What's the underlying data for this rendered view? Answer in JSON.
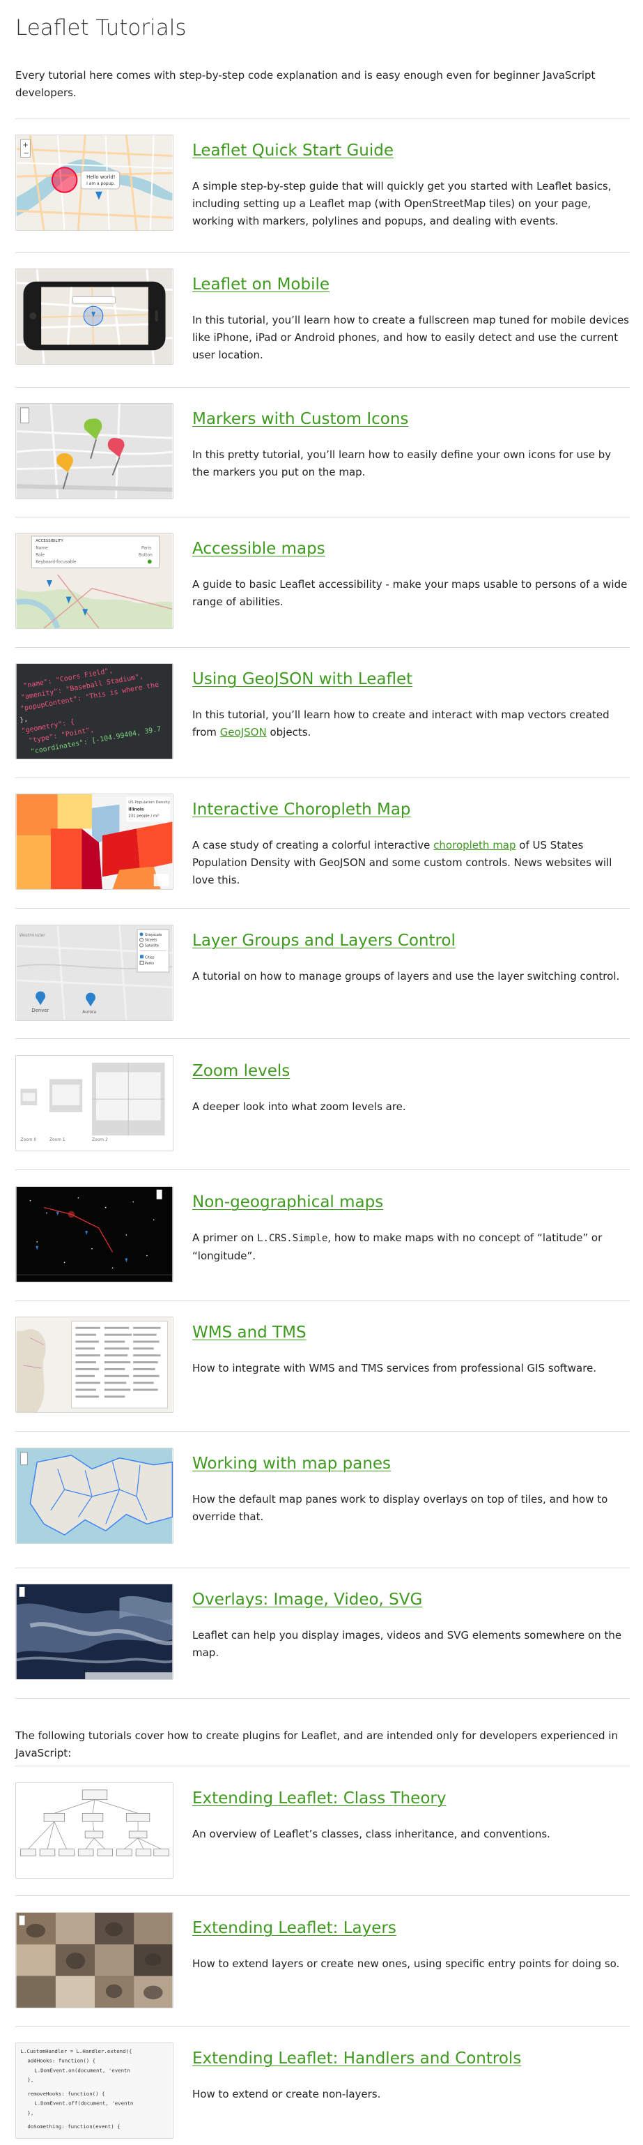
{
  "page": {
    "title": "Leaflet Tutorials",
    "intro": "Every tutorial here comes with step-by-step code explanation and is easy enough even for beginner JavaScript developers.",
    "plugins_intro": "The following tutorials cover how to create plugins for Leaflet, and are intended only for developers experienced in JavaScript:"
  },
  "colors": {
    "link": "#3f9a1f",
    "text": "#222222",
    "separator": "#d9d9d9"
  },
  "tutorials": [
    {
      "title": "Leaflet Quick Start Guide",
      "desc": "A simple step-by-step guide that will quickly get you started with Leaflet basics, including setting up a Leaflet map (with OpenStreetMap tiles) on your page, working with markers, polylines and popups, and dealing with events.",
      "thumb_popup_line1": "Hello world!",
      "thumb_popup_line2": "I am a popup."
    },
    {
      "title": "Leaflet on Mobile",
      "desc": "In this tutorial, you’ll learn how to create a fullscreen map tuned for mobile devices like iPhone, iPad or Android phones, and how to easily detect and use the current user location."
    },
    {
      "title": "Markers with Custom Icons",
      "desc": "In this pretty tutorial, you’ll learn how to easily define your own icons for use by the markers you put on the map."
    },
    {
      "title": "Accessible maps",
      "desc": "A guide to basic Leaflet accessibility - make your maps usable to persons of a wide range of abilities.",
      "thumb_labels": [
        "ACCESSIBILITY",
        "Name",
        "Role",
        "Keyboard-focusable",
        "Paris",
        "Button"
      ]
    },
    {
      "title": "Using GeoJSON with Leaflet",
      "desc_before": "In this tutorial, you’ll learn how to create and interact with map vectors created from ",
      "desc_link": "GeoJSON",
      "desc_after": " objects.",
      "thumb_code": [
        "\"name\": \"Coors Field\",",
        "\"amenity\": \"Baseball Stadium\",",
        "\"popupContent\": \"This is where the",
        "},",
        "\"geometry\": {",
        "\"type\": \"Point\",",
        "\"coordinates\": [-104.99404, 39.7"
      ]
    },
    {
      "title": "Interactive Choropleth Map",
      "desc_before": "A case study of creating a colorful interactive ",
      "desc_link": "choropleth map",
      "desc_after": " of US States Population Density with GeoJSON and some custom controls. News websites will love this.",
      "thumb_labels": [
        "US Population Density",
        "Illinois",
        "231 people / mi²"
      ]
    },
    {
      "title": "Layer Groups and Layers Control",
      "desc": "A tutorial on how to manage groups of layers and use the layer switching control.",
      "thumb_labels": [
        "Grayscale",
        "Streets",
        "Satellite",
        "Cities",
        "Parks",
        "Denver",
        "Aurora",
        "Westminster"
      ]
    },
    {
      "title": "Zoom levels",
      "desc": "A deeper look into what zoom levels are.",
      "thumb_labels": [
        "Zoom 0",
        "Zoom 1",
        "Zoom 2"
      ]
    },
    {
      "title": "Non-geographical maps",
      "desc_before": "A primer on ",
      "desc_code": "L.CRS.Simple",
      "desc_after": ", how to make maps with no concept of “latitude” or “longitude”."
    },
    {
      "title": "WMS and TMS",
      "desc": "How to integrate with WMS and TMS services from professional GIS software."
    },
    {
      "title": "Working with map panes",
      "desc": "How the default map panes work to display overlays on top of tiles, and how to override that."
    },
    {
      "title": "Overlays: Image, Video, SVG",
      "desc": "Leaflet can help you display images, videos and SVG elements somewhere on the map."
    }
  ],
  "plugin_tutorials": [
    {
      "title": "Extending Leaflet: Class Theory",
      "desc": "An overview of Leaflet’s classes, class inheritance, and conventions."
    },
    {
      "title": "Extending Leaflet: Layers",
      "desc": "How to extend layers or create new ones, using specific entry points for doing so."
    },
    {
      "title": "Extending Leaflet: Handlers and Controls",
      "desc": "How to extend or create non-layers.",
      "thumb_code": [
        "L.CustomHandler = L.Handler.extend({",
        "addHooks: function() {",
        "L.DomEvent.on(document, 'eventn",
        "},",
        "removeHooks: function() {",
        "L.DomEvent.off(document, 'eventn",
        "},",
        "doSomething: function(event) {"
      ]
    }
  ]
}
